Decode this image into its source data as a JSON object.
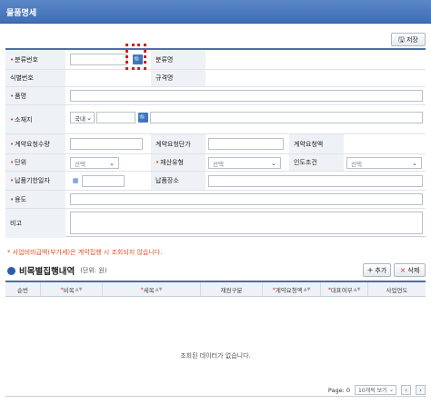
{
  "window": {
    "title": "물품명세"
  },
  "toolbar": {
    "save_label": "저장"
  },
  "form": {
    "category_no_label": "분류번호",
    "category_name_label": "분류명",
    "identifier_no_label": "식별번호",
    "spec_name_label": "규격명",
    "item_name_label": "품명",
    "location_label": "소재지",
    "location_country": "국내",
    "contract_qty_label": "계약요청수량",
    "contract_unit_price_label": "계약요청단가",
    "contract_amount_label": "계약요청액",
    "unit_label": "단위",
    "unit_placeholder": "선택",
    "asset_type_label": "재산유형",
    "asset_type_placeholder": "선택",
    "delivery_terms_label": "인도조건",
    "delivery_terms_placeholder": "선택",
    "delivery_deadline_label": "납품기한일자",
    "delivery_place_label": "납품장소",
    "usage_label": "용도",
    "remarks_label": "비고"
  },
  "notice": "* 사업비비급액(부가세)은 계약집행 시 조회되지 않습니다.",
  "section": {
    "title": "비목별집행내역",
    "unit": "(단위: 원)"
  },
  "grid_actions": {
    "add_label": "추가",
    "delete_label": "삭제"
  },
  "grid": {
    "columns": [
      "순번",
      "비목",
      "세목",
      "재원구분",
      "계약요청액",
      "대표여부",
      "사업연도"
    ],
    "empty_message": "조회된 데이터가 없습니다."
  },
  "pager": {
    "page_label": "Page: 0",
    "page_size": "10개씩 보기"
  }
}
